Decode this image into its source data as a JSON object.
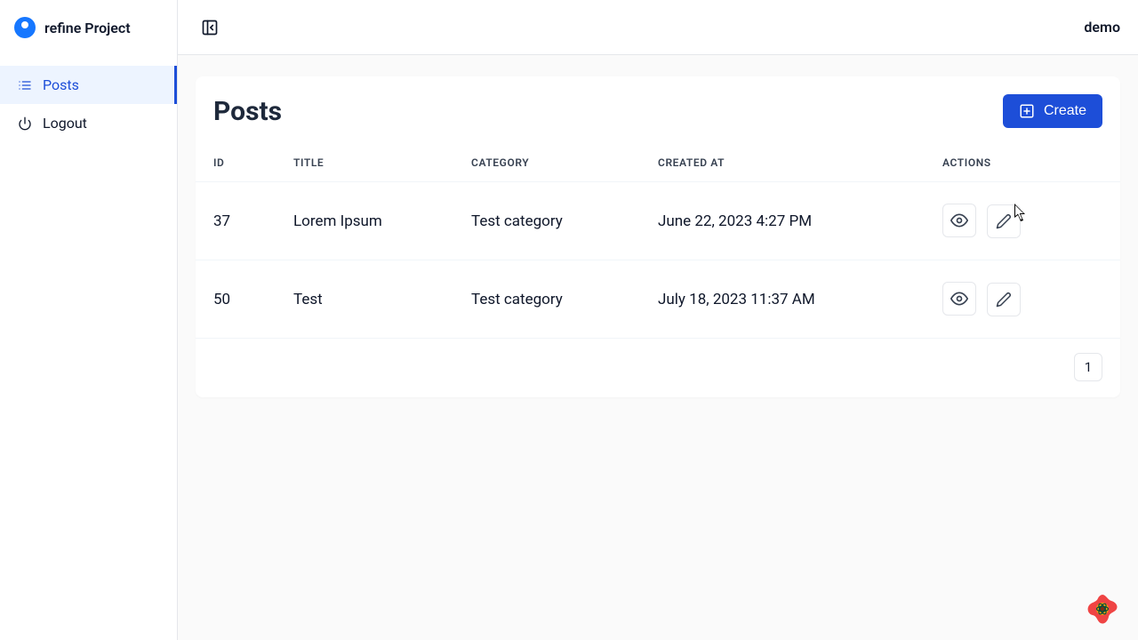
{
  "brand": {
    "name": "refine Project"
  },
  "topbar": {
    "user": "demo"
  },
  "sidebar": {
    "items": [
      {
        "label": "Posts"
      },
      {
        "label": "Logout"
      }
    ]
  },
  "page": {
    "title": "Posts",
    "create_label": "Create"
  },
  "columns": {
    "id": "ID",
    "title": "TITLE",
    "category": "CATEGORY",
    "created_at": "CREATED AT",
    "actions": "ACTIONS"
  },
  "rows": [
    {
      "id": "37",
      "title": "Lorem Ipsum",
      "category": "Test category",
      "created_at": "June 22, 2023 4:27 PM"
    },
    {
      "id": "50",
      "title": "Test",
      "category": "Test category",
      "created_at": "July 18, 2023 11:37 AM"
    }
  ],
  "pagination": {
    "current": "1"
  }
}
